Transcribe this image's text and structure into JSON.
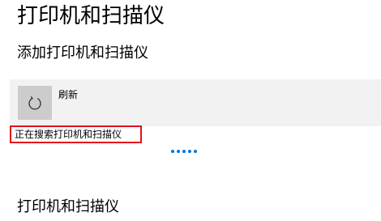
{
  "page": {
    "title": "打印机和扫描仪"
  },
  "add_section": {
    "heading": "添加打印机和扫描仪",
    "refresh_label": "刷新",
    "refresh_icon": "refresh-icon",
    "search_status": "正在搜索打印机和扫描仪",
    "progress_color": "#0078d7",
    "highlight_color": "#e3121b"
  },
  "printers_section": {
    "heading": "打印机和扫描仪"
  }
}
